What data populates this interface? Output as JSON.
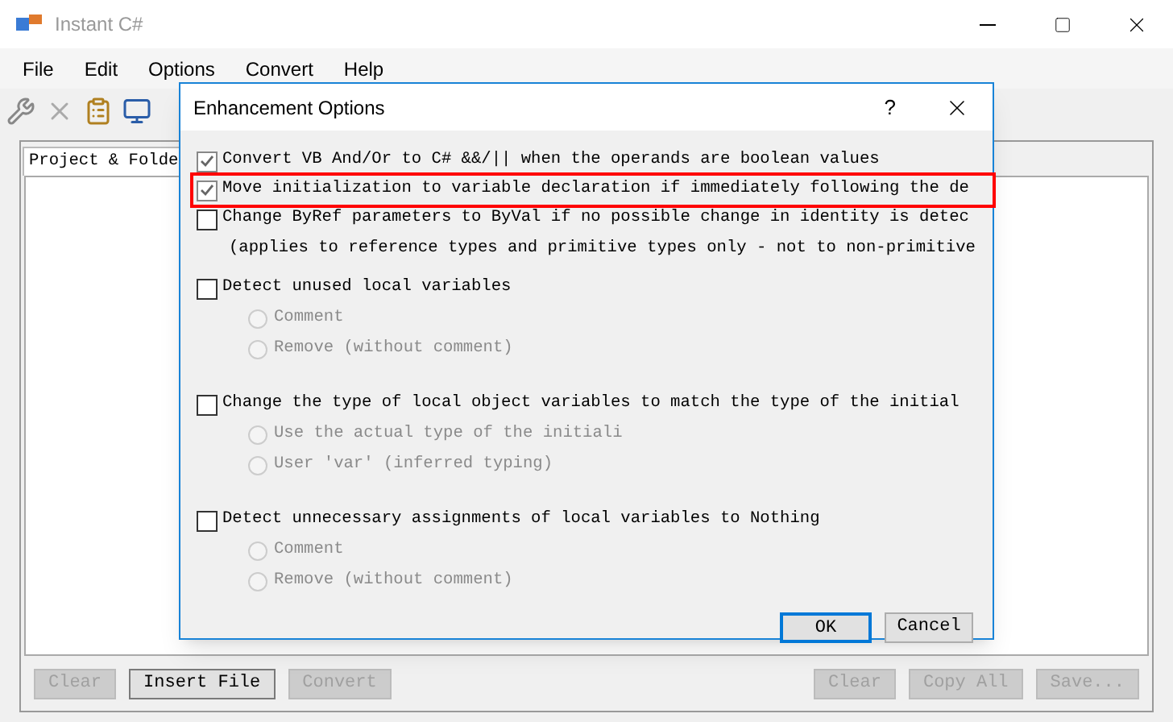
{
  "window": {
    "title": "Instant C#"
  },
  "menu": [
    "File",
    "Edit",
    "Options",
    "Convert",
    "Help"
  ],
  "tab": {
    "label": "Project & Folde"
  },
  "bottom_buttons_left": [
    {
      "label": "Clear",
      "disabled": true
    },
    {
      "label": "Insert File",
      "disabled": false
    },
    {
      "label": "Convert",
      "disabled": true
    }
  ],
  "bottom_buttons_right": [
    {
      "label": "Clear",
      "disabled": true
    },
    {
      "label": "Copy All",
      "disabled": true
    },
    {
      "label": "Save...",
      "disabled": true
    }
  ],
  "dialog": {
    "title": "Enhancement Options",
    "help": "?",
    "options": [
      {
        "kind": "checkbox",
        "label": "Convert VB And/Or to C# &&/|| when the operands are boolean values",
        "checked": true,
        "highlighted": false
      },
      {
        "kind": "checkbox",
        "label": "Move initialization to variable declaration if immediately following the de",
        "checked": true,
        "highlighted": true
      },
      {
        "kind": "checkbox",
        "label": "Change ByRef parameters to ByVal if no possible change in identity is detec",
        "checked": false,
        "highlighted": false
      },
      {
        "kind": "note",
        "label": "(applies to reference types and primitive types only - not to non-primitive"
      },
      {
        "kind": "checkbox",
        "label": "Detect unused local variables",
        "checked": false,
        "highlighted": false,
        "choices": [
          {
            "label": "Comment",
            "selected": false,
            "disabled": true
          },
          {
            "label": "Remove (without comment)",
            "selected": false,
            "disabled": true
          }
        ]
      },
      {
        "kind": "checkbox",
        "label": "Change the type of local object variables to match the type of the initial",
        "checked": false,
        "highlighted": false,
        "choices": [
          {
            "label": "Use the actual type of the initiali",
            "selected": false,
            "disabled": true
          },
          {
            "label": "User 'var' (inferred typing)",
            "selected": false,
            "disabled": true
          }
        ]
      },
      {
        "kind": "checkbox",
        "label": "Detect unnecessary assignments of local variables to Nothing",
        "checked": false,
        "highlighted": false,
        "choices": [
          {
            "label": "Comment",
            "selected": false,
            "disabled": true
          },
          {
            "label": "Remove (without comment)",
            "selected": false,
            "disabled": true
          }
        ]
      }
    ],
    "buttons": [
      {
        "label": "OK",
        "default": true
      },
      {
        "label": "Cancel",
        "default": false
      }
    ]
  }
}
